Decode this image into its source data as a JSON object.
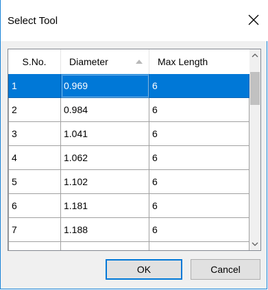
{
  "dialog": {
    "title": "Select Tool",
    "close_icon": "close-icon"
  },
  "table": {
    "columns": [
      "S.No.",
      "Diameter",
      "Max Length"
    ],
    "sorted_column": "Diameter",
    "sort_direction": "ascending",
    "sort_icon": "sort-ascending-icon",
    "selected_row": 0,
    "rows": [
      {
        "sno": "1",
        "diameter": "0.969",
        "max_length": "6"
      },
      {
        "sno": "2",
        "diameter": "0.984",
        "max_length": "6"
      },
      {
        "sno": "3",
        "diameter": "1.041",
        "max_length": "6"
      },
      {
        "sno": "4",
        "diameter": "1.062",
        "max_length": "6"
      },
      {
        "sno": "5",
        "diameter": "1.102",
        "max_length": "6"
      },
      {
        "sno": "6",
        "diameter": "1.181",
        "max_length": "6"
      },
      {
        "sno": "7",
        "diameter": "1.188",
        "max_length": "6"
      }
    ]
  },
  "scrollbar": {
    "up_icon": "chevron-up-icon",
    "down_icon": "chevron-down-icon"
  },
  "buttons": {
    "ok_label": "OK",
    "cancel_label": "Cancel"
  },
  "colors": {
    "selection": "#0078d7",
    "window_border": "#1883d7",
    "dialog_background": "#f0f0f0"
  }
}
